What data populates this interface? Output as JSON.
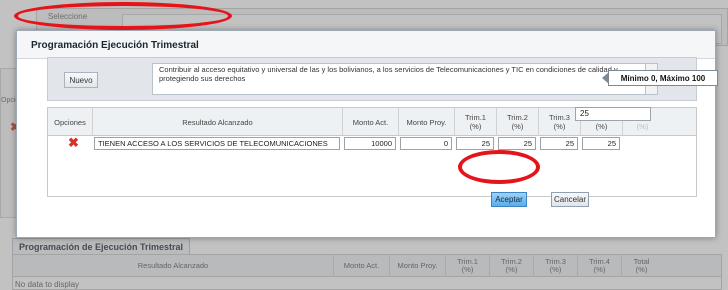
{
  "background": {
    "selector_label": "Seleccione",
    "options_label": "Opciones",
    "section_tab": "Programación de Ejecución Trimestral",
    "table_headers": [
      "Resultado Alcanzado",
      "Monto Act.",
      "Monto Proy.",
      "Trim.1\n(%)",
      "Trim.2\n(%)",
      "Trim.3\n(%)",
      "Trim.4\n(%)",
      "Total\n(%)"
    ],
    "no_data": "No data to display"
  },
  "dialog": {
    "title": "Programación Ejecución Trimestral",
    "new_button": "Nuevo",
    "description": "Contribuir al acceso equitativo y universal de las y los bolivianos, a los servicios de Telecomunicaciones y TIC en condiciones de calidad y protegiendo sus derechos",
    "grid": {
      "headers": [
        "Opciones",
        "Resultado Alcanzado",
        "Monto Act.",
        "Monto Proy.",
        "Trim.1\n(%)",
        "Trim.2\n(%)",
        "Trim.3\n(%)",
        "Trim.4\n(%)",
        "Total\n(%)"
      ],
      "row": {
        "resultado": "TIENEN ACCESO A LOS SERVICIOS DE TELECOMUNICACIONES",
        "monto_act": "10000",
        "monto_proy": "0",
        "trim1": "25",
        "trim2": "25",
        "trim3": "25",
        "trim4": "25"
      },
      "dropdown_value": "25"
    },
    "tooltip": "Mínimo 0, Máximo 100",
    "accept_button": "Aceptar",
    "cancel_button": "Cancelar"
  },
  "colors": {
    "highlight": "#e5141a",
    "accept_button": "#59aeeb",
    "delete_icon": "#d6322a"
  }
}
